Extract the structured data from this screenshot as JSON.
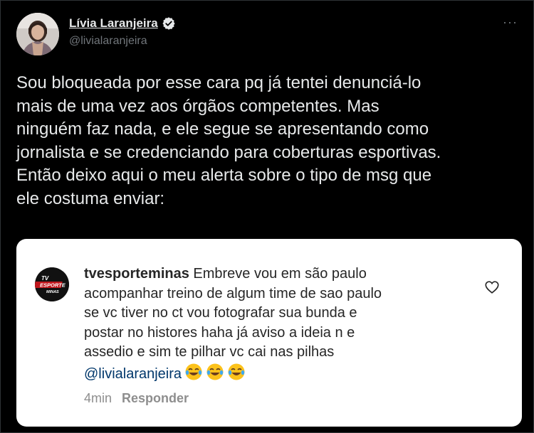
{
  "tweet": {
    "author": {
      "display_name": "Lívia Laranjeira",
      "handle": "@livialaranjeira",
      "verified": true
    },
    "more_icon": "more-horizontal-icon",
    "text_lines": [
      "Sou bloqueada por esse cara pq já tentei denunciá-lo",
      "mais de uma vez aos órgãos competentes. Mas",
      "ninguém faz nada, e ele segue se apresentando como",
      "jornalista e se credenciando para coberturas esportivas.",
      "Então deixo aqui o meu alerta sobre o tipo de msg que",
      "ele costuma enviar:"
    ]
  },
  "embedded_comment": {
    "avatar_text": [
      "TV",
      "ESPORTE",
      "MINAS"
    ],
    "username": "tvesporteminas",
    "lines": [
      " Embreve vou em são paulo",
      "acompanhar treino de algum time de sao paulo",
      "se vc tiver no ct vou fotografar sua bunda e",
      "postar no histores haha já aviso a ideia n e",
      "assedio e sim te pilhar vc cai nas pilhas"
    ],
    "mention": "@livialaranjeira",
    "emojis": [
      "😂",
      "😂",
      "😂"
    ],
    "time": "4min",
    "reply_label": "Responder",
    "like_icon": "heart-outline-icon"
  },
  "colors": {
    "background": "#000000",
    "text": "#e7e9ea",
    "muted": "#71767b",
    "card": "#ffffff",
    "mention": "#00376b"
  }
}
